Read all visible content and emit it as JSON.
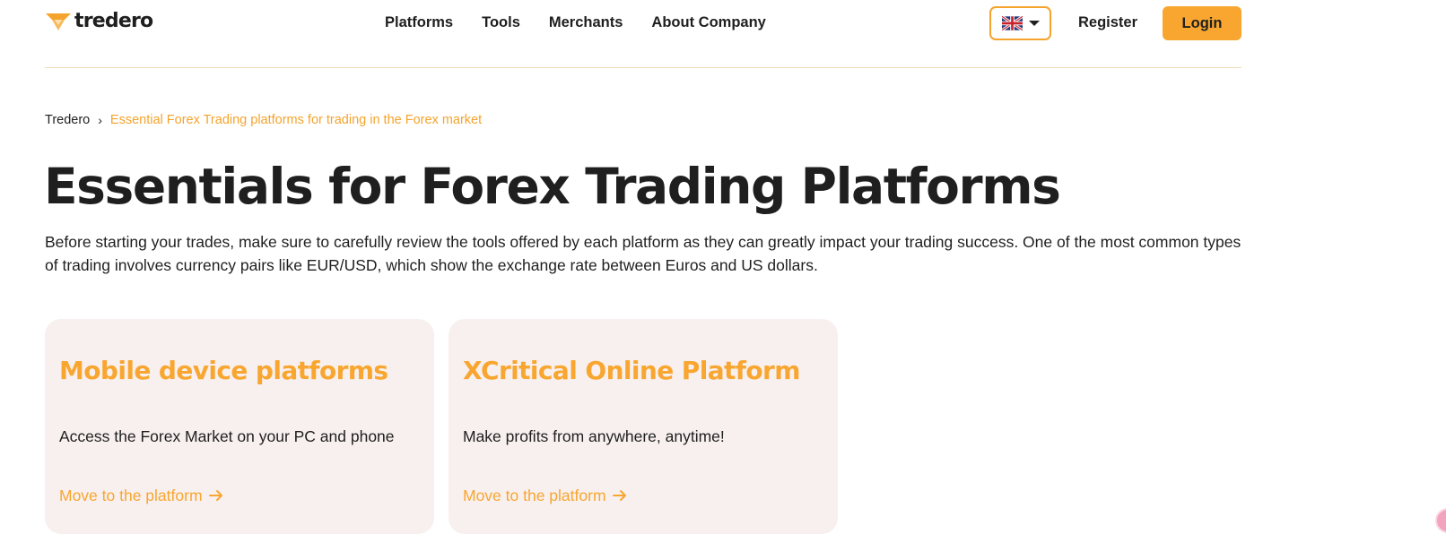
{
  "header": {
    "logo_text": "tredero",
    "logo_icon": "tredero-logo-icon",
    "nav": [
      {
        "label": "Platforms"
      },
      {
        "label": "Tools"
      },
      {
        "label": "Merchants"
      },
      {
        "label": "About Company"
      }
    ],
    "language_icon": "uk-flag-icon",
    "register_label": "Register",
    "login_label": "Login"
  },
  "breadcrumb": {
    "home": "Tredero",
    "separator": "›",
    "current": "Essential Forex Trading platforms for trading in the Forex market"
  },
  "page": {
    "title": "Essentials for Forex Trading Platforms",
    "intro": "Before starting your trades, make sure to carefully review the tools offered by each platform as they can greatly impact your trading success. One of the most common types of trading involves currency pairs like EUR/USD, which show the exchange rate between Euros and US dollars."
  },
  "cards": [
    {
      "title": "Mobile device platforms",
      "text": "Access the Forex Market on your PC and phone",
      "link": "Move to the platform"
    },
    {
      "title": "XCritical Online Platform",
      "text": "Make profits from anywhere, anytime!",
      "link": "Move to the platform"
    }
  ],
  "colors": {
    "accent": "#f8a630",
    "card_background": "#f8f0ef",
    "divider": "#f3dcb6",
    "text": "#1f1f1f"
  }
}
